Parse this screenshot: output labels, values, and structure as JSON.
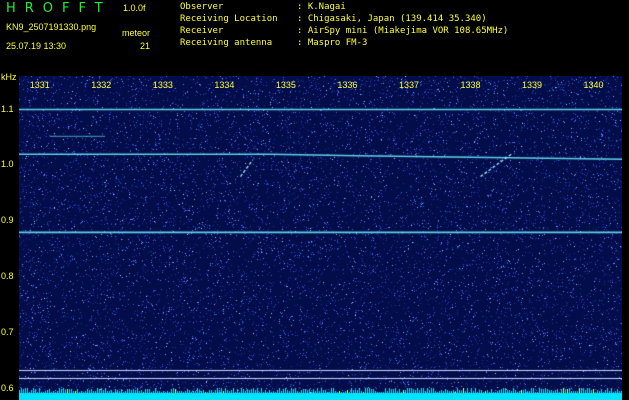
{
  "app": {
    "title": "HROFFT",
    "version": "1.0.0f"
  },
  "file": {
    "name": "KN9_2507191330.png",
    "timestamp": "25.07.19 13:30"
  },
  "meteor": {
    "label": "meteor",
    "count": "21"
  },
  "info": [
    {
      "key": "Observer",
      "value": ": K.Nagai"
    },
    {
      "key": "Receiving Location",
      "value": ": Chigasaki, Japan (139.414 35.340)"
    },
    {
      "key": "Receiver",
      "value": ": AirSpy mini (Miakejima VOR 108.65MHz)"
    },
    {
      "key": "Receiving antenna",
      "value": ": Maspro FM-3"
    }
  ],
  "chart_data": {
    "type": "heatmap",
    "ylabel": "kHz",
    "x_ticks": [
      "1331",
      "1332",
      "1333",
      "1334",
      "1335",
      "1336",
      "1337",
      "1338",
      "1339",
      "1340"
    ],
    "y_ticks": [
      "1.1",
      "1.0",
      "0.9",
      "0.8",
      "0.7",
      "0.6"
    ],
    "ylim": [
      0.58,
      1.16
    ],
    "xlim": [
      1330.5,
      1340.3
    ],
    "carriers_khz": [
      1.1,
      1.052,
      1.02,
      0.88
    ],
    "meteor_streaks": [
      {
        "x": [
          1334.1,
          1334.3
        ],
        "y": [
          0.98,
          1.01
        ]
      },
      {
        "x": [
          1338.0,
          1338.5
        ],
        "y": [
          0.98,
          1.02
        ]
      }
    ],
    "colors": {
      "background": "#030d4a",
      "noise": "#4a6cff",
      "carrier": "#66ddee",
      "label": "#ffff33",
      "baseline": "#00e5ff"
    }
  }
}
